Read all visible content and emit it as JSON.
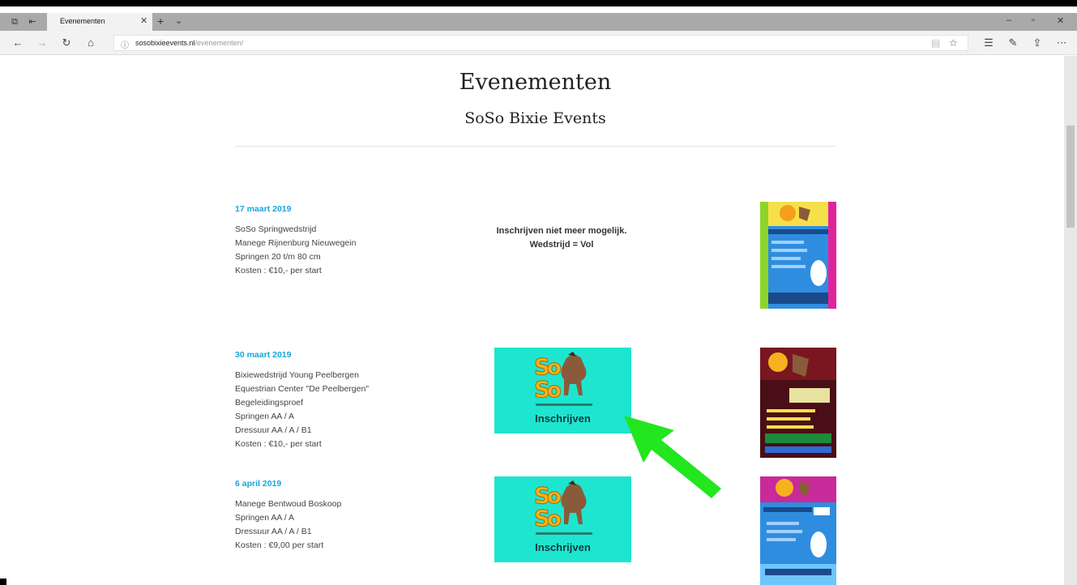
{
  "browser": {
    "tab_title": "Evenementen",
    "url_host": "sosobixieevents.nl",
    "url_path": "/evenementen/",
    "icons": [
      "tab-actions-icon",
      "tab-aside-icon",
      "close-icon",
      "plus-icon",
      "chevron-down-icon",
      "minimize-icon",
      "restore-icon",
      "close-window-icon",
      "back-icon",
      "forward-icon",
      "refresh-icon",
      "home-icon",
      "info-icon",
      "reading-view-icon",
      "star-icon",
      "favorites-icon",
      "pen-icon",
      "share-icon",
      "more-icon"
    ]
  },
  "page": {
    "title": "Evenementen",
    "subtitle": "SoSo Bixie Events"
  },
  "events": [
    {
      "date": "17 maart 2019",
      "lines": [
        "SoSo Springwedstrijd",
        "Manege Rijnenburg Nieuwegein",
        "Springen 20 t/m 80 cm",
        "Kosten : €10,- per start"
      ],
      "status_lines": [
        "Inschrijven niet meer mogelijk.",
        "Wedstrijd = Vol"
      ]
    },
    {
      "date": "30 maart 2019",
      "lines": [
        "Bixiewedstrijd Young Peelbergen",
        "Equestrian Center \"De Peelbergen\"",
        "Begeleidingsproef",
        "Springen AA / A",
        "Dressuur AA / A / B1",
        "Kosten : €10,- per start"
      ],
      "button_label": "Inschrijven"
    },
    {
      "date": "6 april 2019",
      "lines": [
        "Manege Bentwoud Boskoop",
        "Springen AA / A",
        "Dressuur AA / A / B1",
        "Kosten : €9,00 per start"
      ],
      "button_label": "Inschrijven"
    }
  ],
  "colors": {
    "accent_date": "#1aa6d9",
    "button_bg": "#1ee5d0",
    "arrow": "#22e61e"
  }
}
